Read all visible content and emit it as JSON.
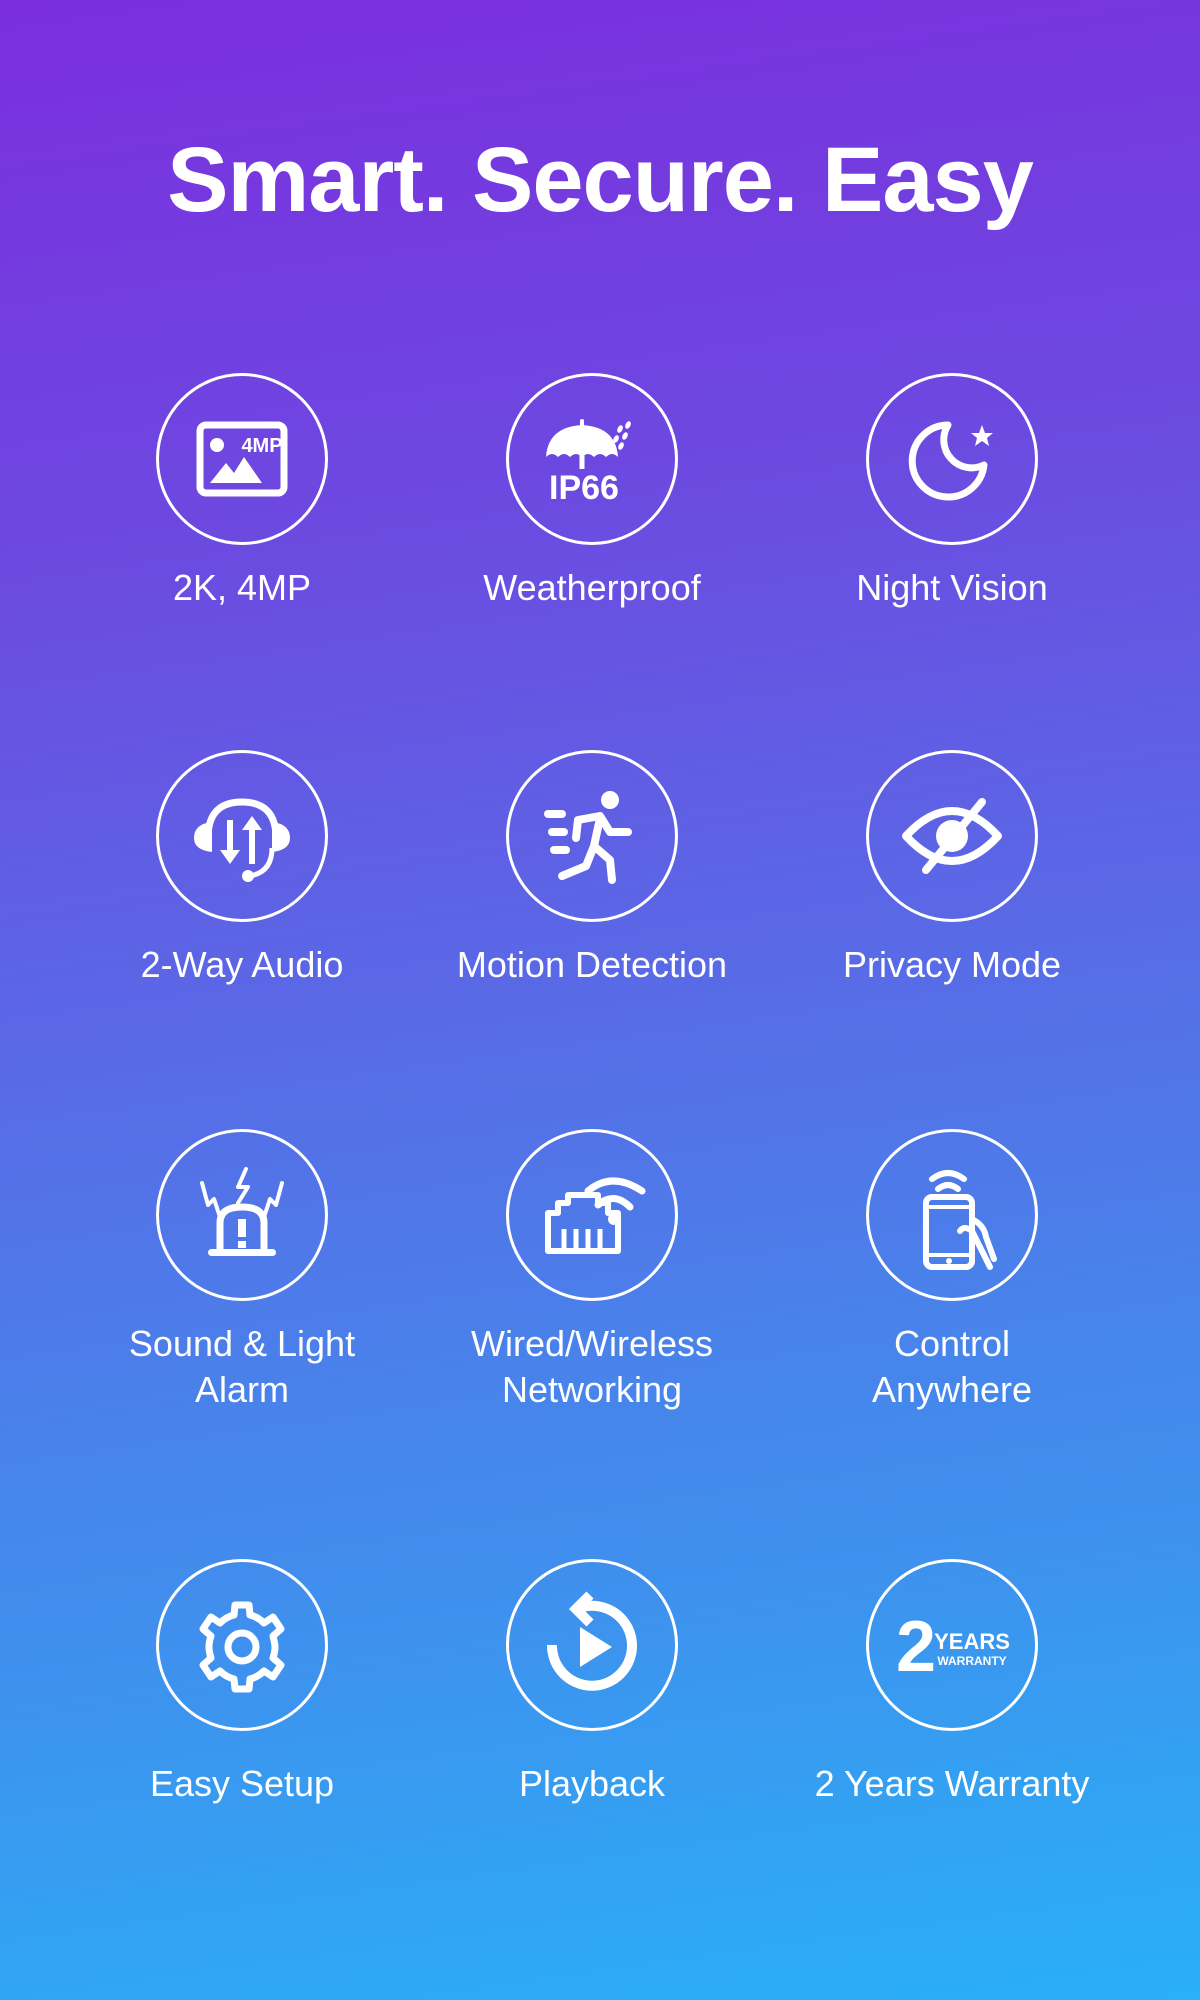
{
  "title": "Smart. Secure. Easy",
  "colors": {
    "gradient_top": "#7b2ede",
    "gradient_bottom": "#29b0f7",
    "foreground": "#ffffff"
  },
  "features": [
    {
      "label": "2K, 4MP",
      "icon": "image-4mp-icon",
      "icon_text": "4MP"
    },
    {
      "label": "Weatherproof",
      "icon": "umbrella-ip66-icon",
      "icon_text": "IP66"
    },
    {
      "label": "Night Vision",
      "icon": "moon-star-icon"
    },
    {
      "label": "2-Way Audio",
      "icon": "headset-arrows-icon"
    },
    {
      "label": "Motion Detection",
      "icon": "running-person-icon"
    },
    {
      "label": "Privacy Mode",
      "icon": "eye-off-icon"
    },
    {
      "label_line1": "Sound & Light",
      "label_line2": "Alarm",
      "icon": "siren-alarm-icon"
    },
    {
      "label_line1": "Wired/Wireless",
      "label_line2": "Networking",
      "icon": "ethernet-wifi-icon"
    },
    {
      "label_line1": "Control",
      "label_line2": "Anywhere",
      "icon": "phone-hand-icon"
    },
    {
      "label": "Easy Setup",
      "icon": "gear-icon"
    },
    {
      "label": "Playback",
      "icon": "replay-play-icon"
    },
    {
      "label": "2 Years Warranty",
      "icon": "warranty-badge-icon",
      "icon_number": "2",
      "icon_text_1": "YEARS",
      "icon_text_2": "WARRANTY"
    }
  ]
}
